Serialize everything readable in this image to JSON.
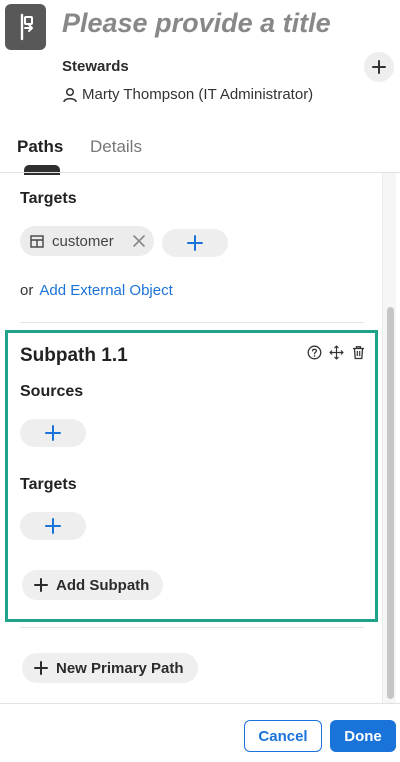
{
  "header": {
    "title": "Please provide a title",
    "stewards_label": "Stewards",
    "steward_name": "Marty Thompson (IT Administrator)"
  },
  "tabs": [
    {
      "label": "Paths",
      "active": true
    },
    {
      "label": "Details",
      "active": false
    }
  ],
  "path": {
    "targets_label": "Targets",
    "target_chip": "customer",
    "or_text": "or",
    "add_external_link": "Add External Object"
  },
  "subpath": {
    "title": "Subpath 1.1",
    "sources_label": "Sources",
    "targets_label": "Targets",
    "add_subpath_label": "Add Subpath"
  },
  "new_primary_path_label": "New Primary Path",
  "footer": {
    "cancel_label": "Cancel",
    "done_label": "Done"
  },
  "icons": {
    "app": "lineage-path-icon",
    "steward": "person-icon",
    "table": "table-icon",
    "subpath_actions": [
      "help-icon",
      "move-icon",
      "trash-icon"
    ]
  },
  "colors": {
    "accent_blue": "#1a73d9",
    "highlight_green": "#1fa38a",
    "title_gray": "#888888"
  }
}
